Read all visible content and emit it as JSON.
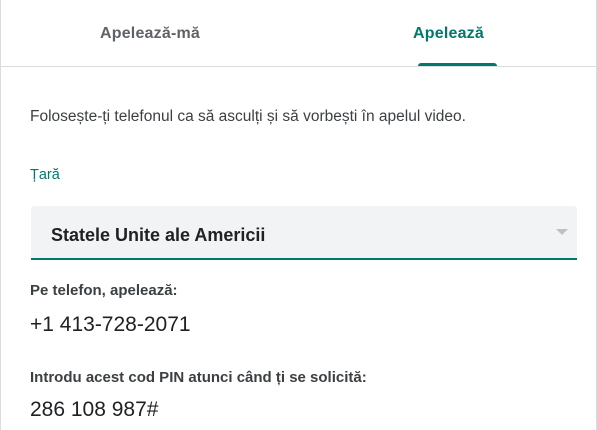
{
  "tabs": [
    {
      "label": "Apelează-mă",
      "active": false
    },
    {
      "label": "Apelează",
      "active": true
    }
  ],
  "description": "Folosește-ți telefonul ca să asculți și să vorbești în apelul video.",
  "country": {
    "label": "Țară",
    "selected": "Statele Unite ale Americii",
    "icon": "chevron-down-icon"
  },
  "phone": {
    "label": "Pe telefon, apelează:",
    "number": "+1 413-728-2071"
  },
  "pin": {
    "label": "Introdu acest cod PIN atunci când ți se solicită:",
    "value": "286 108 987#"
  },
  "colors": {
    "accent": "#00796b",
    "text": "#202124",
    "muted": "#5f6368",
    "field_bg": "#f1f3f4",
    "divider": "#dadce0"
  }
}
